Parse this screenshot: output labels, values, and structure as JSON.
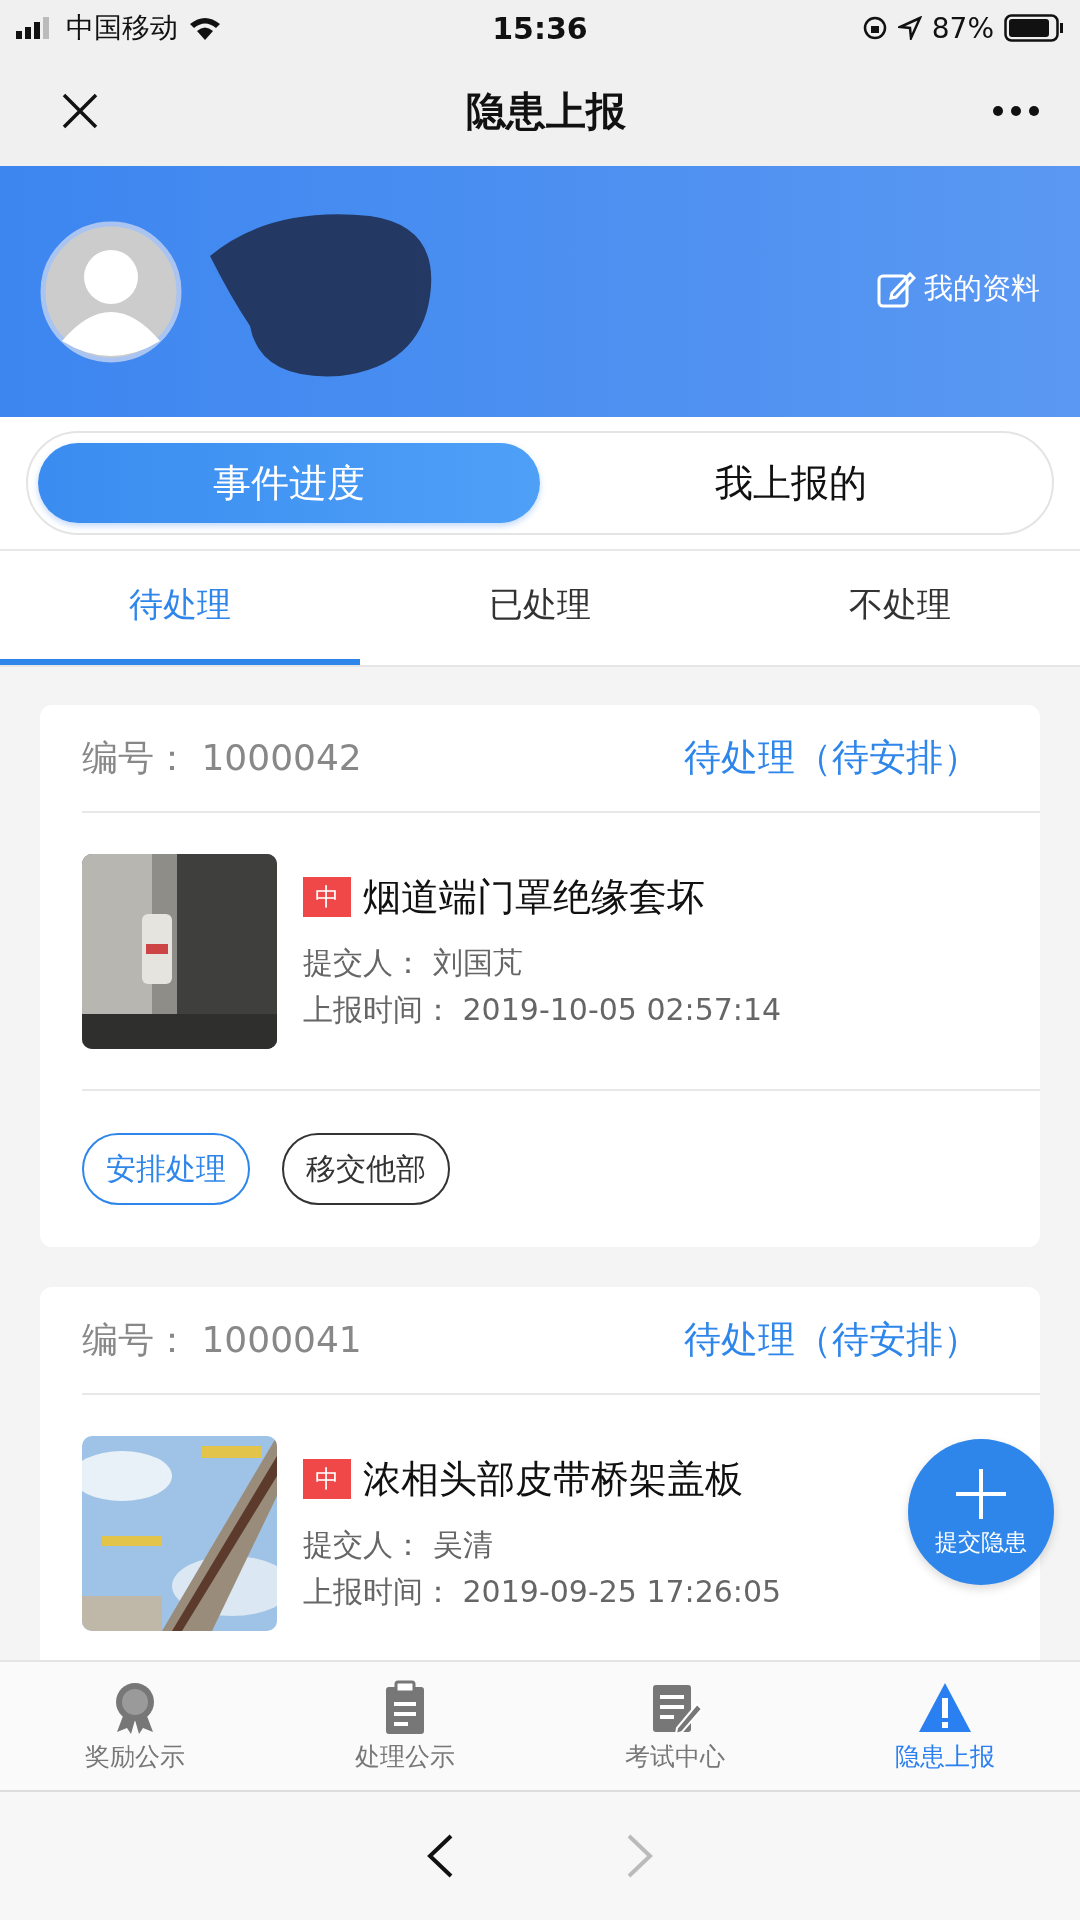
{
  "status_bar": {
    "carrier": "中国移动",
    "time": "15:36",
    "battery": "87%"
  },
  "nav_bar": {
    "title": "隐患上报"
  },
  "profile": {
    "link": "我的资料"
  },
  "segments": [
    {
      "label": "事件进度",
      "selected": true
    },
    {
      "label": "我上报的",
      "selected": false
    }
  ],
  "tabs": [
    {
      "label": "待处理",
      "selected": true
    },
    {
      "label": "已处理",
      "selected": false
    },
    {
      "label": "不处理",
      "selected": false
    }
  ],
  "cards": [
    {
      "id_label": "编号：",
      "id": "1000042",
      "status": "待处理（待安排）",
      "level": "中",
      "title": "烟道端门罩绝缘套坏",
      "submitter_label": "提交人：",
      "submitter": "刘国芃",
      "time_label": "上报时间：",
      "time": "2019-10-05 02:57:14",
      "actions": [
        {
          "label": "安排处理",
          "kind": "primary"
        },
        {
          "label": "移交他部",
          "kind": "secondary"
        }
      ]
    },
    {
      "id_label": "编号：",
      "id": "1000041",
      "status": "待处理（待安排）",
      "level": "中",
      "title": "浓相头部皮带桥架盖板",
      "submitter_label": "提交人：",
      "submitter": "吴清",
      "time_label": "上报时间：",
      "time": "2019-09-25 17:26:05"
    }
  ],
  "fab": {
    "label": "提交隐患"
  },
  "bottom_nav": [
    {
      "label": "奖励公示",
      "selected": false
    },
    {
      "label": "处理公示",
      "selected": false
    },
    {
      "label": "考试中心",
      "selected": false
    },
    {
      "label": "隐患上报",
      "selected": true
    }
  ],
  "browser_bar": {
    "back_disabled": false,
    "forward_disabled": true
  }
}
